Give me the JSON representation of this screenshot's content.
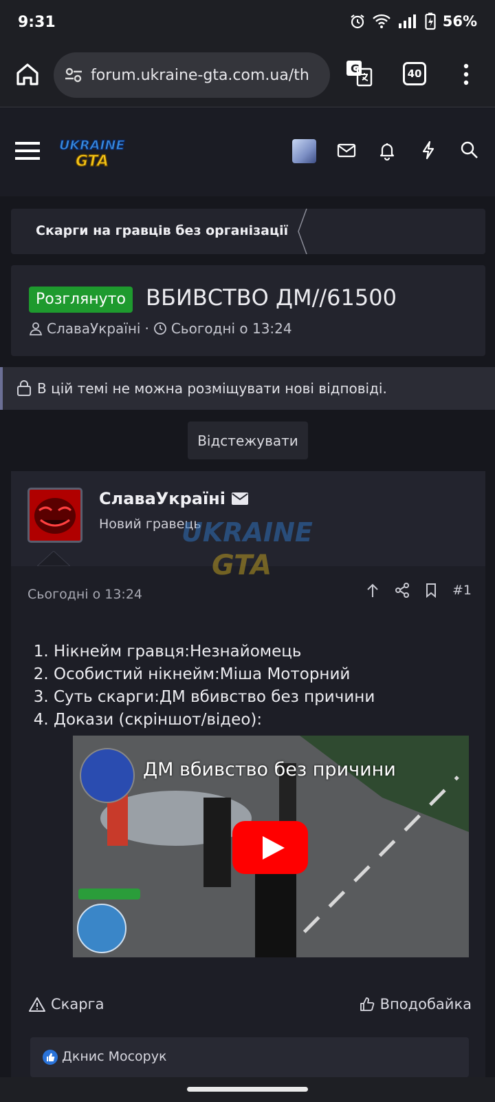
{
  "status": {
    "time": "9:31",
    "battery": "56%"
  },
  "browser": {
    "url": "forum.ukraine-gta.com.ua/th",
    "tabs_count": "40"
  },
  "breadcrumb": "Скарги на гравців без організації",
  "thread": {
    "badge": "Розглянуто",
    "title": "ВБИВСТВО ДМ//61500",
    "author": "СлаваУкраїні",
    "date": "Сьогодні о 13:24"
  },
  "notice": "В цій темі не можна розміщувати нові відповіді.",
  "watch_label": "Відстежувати",
  "post": {
    "author": "СлаваУкраїні",
    "rank": "Новий гравець",
    "date": "Сьогодні о 13:24",
    "number": "#1",
    "items": [
      "Нікнейм гравця:Незнайомець",
      "Особистий нікнейм:Міша Моторний",
      "Суть скарги:ДМ вбивство без причини",
      "Докази (скріншот/відео):"
    ],
    "video_title": "ДМ вбивство без причини",
    "report_label": "Скарга",
    "like_label": "Вподобайка",
    "liked_by": "Дкнис Мосорук"
  },
  "colors": {
    "accent_green": "#1e9a2e",
    "youtube_red": "#ff0000",
    "page_bg": "#16171d"
  }
}
